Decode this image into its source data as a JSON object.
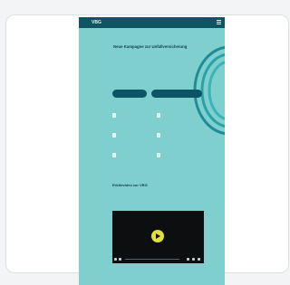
{
  "logo": {
    "text": "VBG"
  },
  "hero": {
    "headline": "Neue Kampagne zur Unfallversicherung",
    "subline": "",
    "buttons": [
      {
        "label": ""
      },
      {
        "label": ""
      }
    ]
  },
  "stats": [
    {
      "value": "",
      "label": ""
    },
    {
      "value": "",
      "label": ""
    },
    {
      "value": "",
      "label": ""
    },
    {
      "value": "",
      "label": ""
    },
    {
      "value": "",
      "label": ""
    },
    {
      "value": "",
      "label": ""
    }
  ],
  "section": {
    "title": "Erklärvideo zur VBG",
    "text": ""
  },
  "video": {
    "state": "paused"
  },
  "bottom": {
    "title": ""
  },
  "colors": {
    "page_bg": "#7ecfcd",
    "header_bg": "#0d5564",
    "dark_text": "#0d3e4d",
    "play_button": "#e3df3a"
  }
}
